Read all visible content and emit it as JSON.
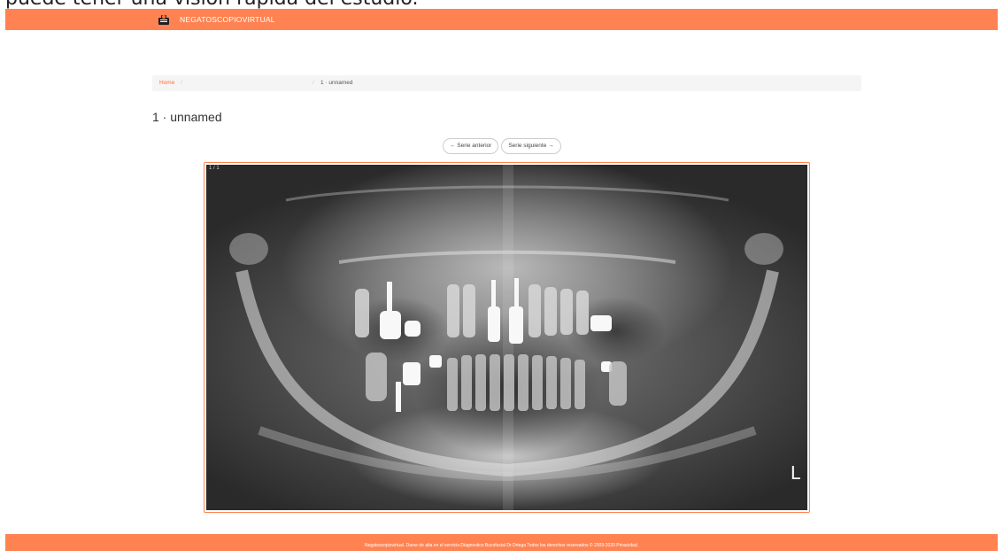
{
  "caption": "puede tener una visión rápida del estudio.",
  "navbar": {
    "brand": "NEGATOSCOPIOVIRTUAL",
    "brand_icon": "camera-icon",
    "color": "#ff8352"
  },
  "breadcrumb": {
    "home": "Home",
    "separator": "/",
    "current": "1 · unnamed"
  },
  "title": "1 · unnamed",
  "pager": {
    "prev": "← Serie anterior",
    "next": "Serie siguiente →"
  },
  "viewer": {
    "counter": "1 / 1",
    "orientation": "L"
  },
  "footer": {
    "text": "Negatoscopiovirtual. Darse de alta en el servicio.Diagnostico Bucofacial Dr.Ortega Todos los derechos reservados © 2009-2020 Privacidad."
  }
}
